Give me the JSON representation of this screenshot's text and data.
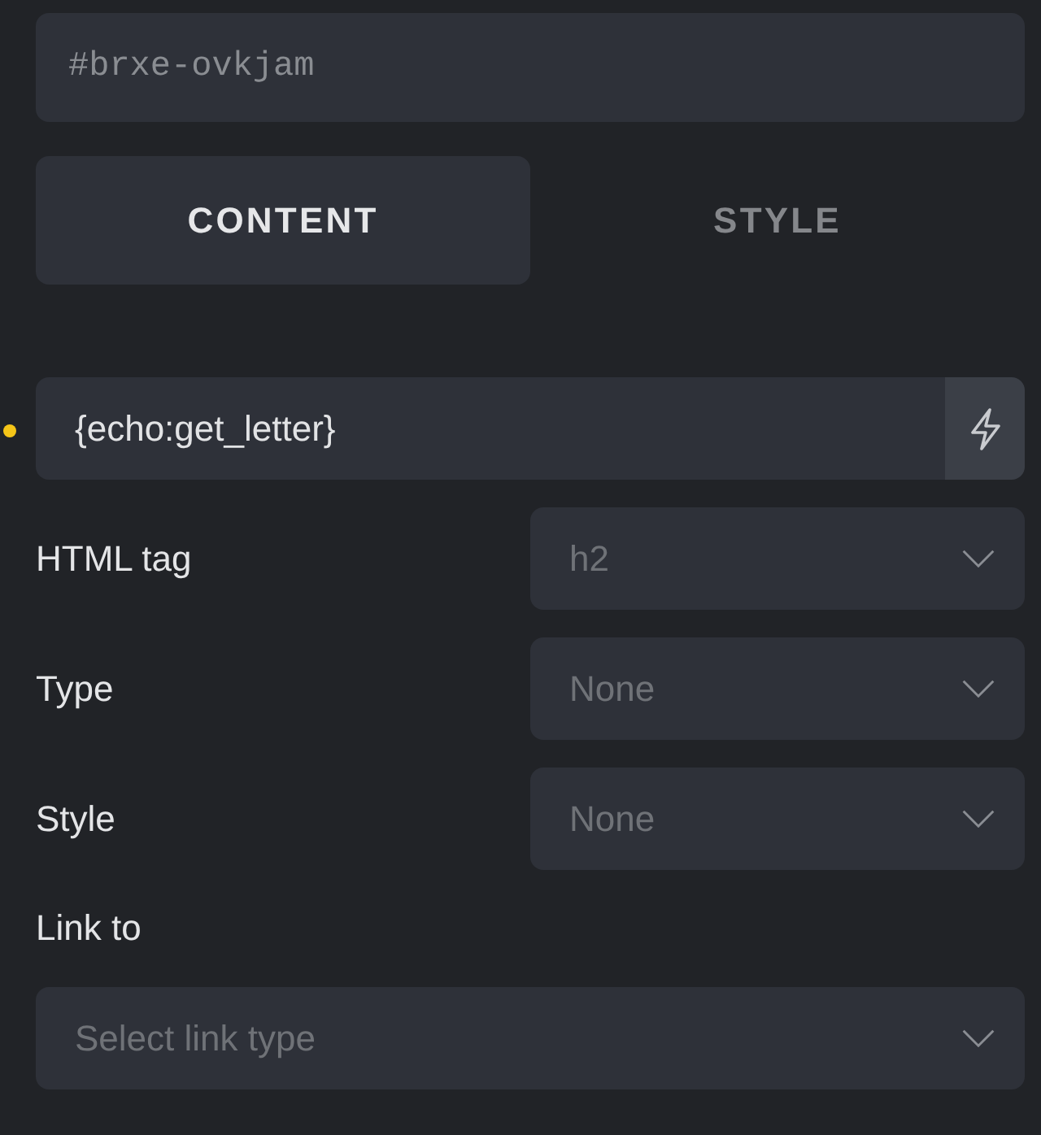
{
  "css_id_field": {
    "placeholder": "#brxe-ovkjam"
  },
  "tabs": [
    {
      "label": "CONTENT",
      "selected": true
    },
    {
      "label": "STYLE",
      "selected": false
    }
  ],
  "text_field": {
    "value": "{echo:get_letter}",
    "modified": true
  },
  "controls": [
    {
      "kind": "inline-select",
      "label": "HTML tag",
      "placeholder": "h2"
    },
    {
      "kind": "inline-select",
      "label": "Type",
      "placeholder": "None"
    },
    {
      "kind": "inline-select",
      "label": "Style",
      "placeholder": "None"
    },
    {
      "kind": "stacked-select",
      "label": "Link to",
      "placeholder": "Select link type"
    }
  ]
}
